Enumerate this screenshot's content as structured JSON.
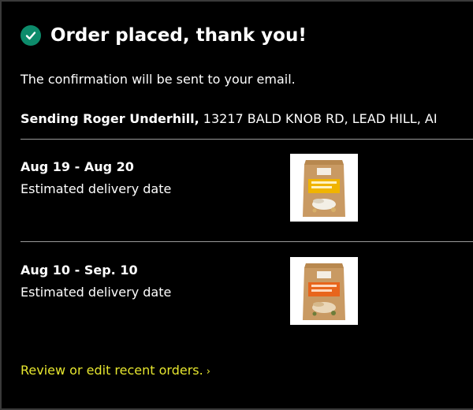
{
  "header": {
    "title": "Order placed, thank you!"
  },
  "confirmation_text": "The confirmation will be sent to your email.",
  "shipping": {
    "prefix": "Sending Roger Underhill,",
    "address": "13217 BALD KNOB RD, LEAD HILL, AI"
  },
  "deliveries": [
    {
      "date_range": "Aug 19 - Aug 20",
      "label": "Estimated delivery date",
      "product": {
        "brand": "NATURAL BLOCK",
        "name_top": "SUNFLOWER",
        "name_bottom": "SEED FLOUR",
        "accent": "#f0b400"
      }
    },
    {
      "date_range": "Aug 10 - Sep. 10",
      "label": "Estimated delivery date",
      "product": {
        "brand": "NATURAL BLOCK",
        "name_top": "PUMPKIN",
        "name_bottom": "SEED FLOUR",
        "accent": "#e8651c"
      }
    }
  ],
  "review_link": {
    "label": "Review or edit recent orders.",
    "chevron": "›"
  },
  "colors": {
    "background": "#000000",
    "check": "#0d8b6b",
    "link": "#e6e62f",
    "divider": "#9a9a9a"
  }
}
